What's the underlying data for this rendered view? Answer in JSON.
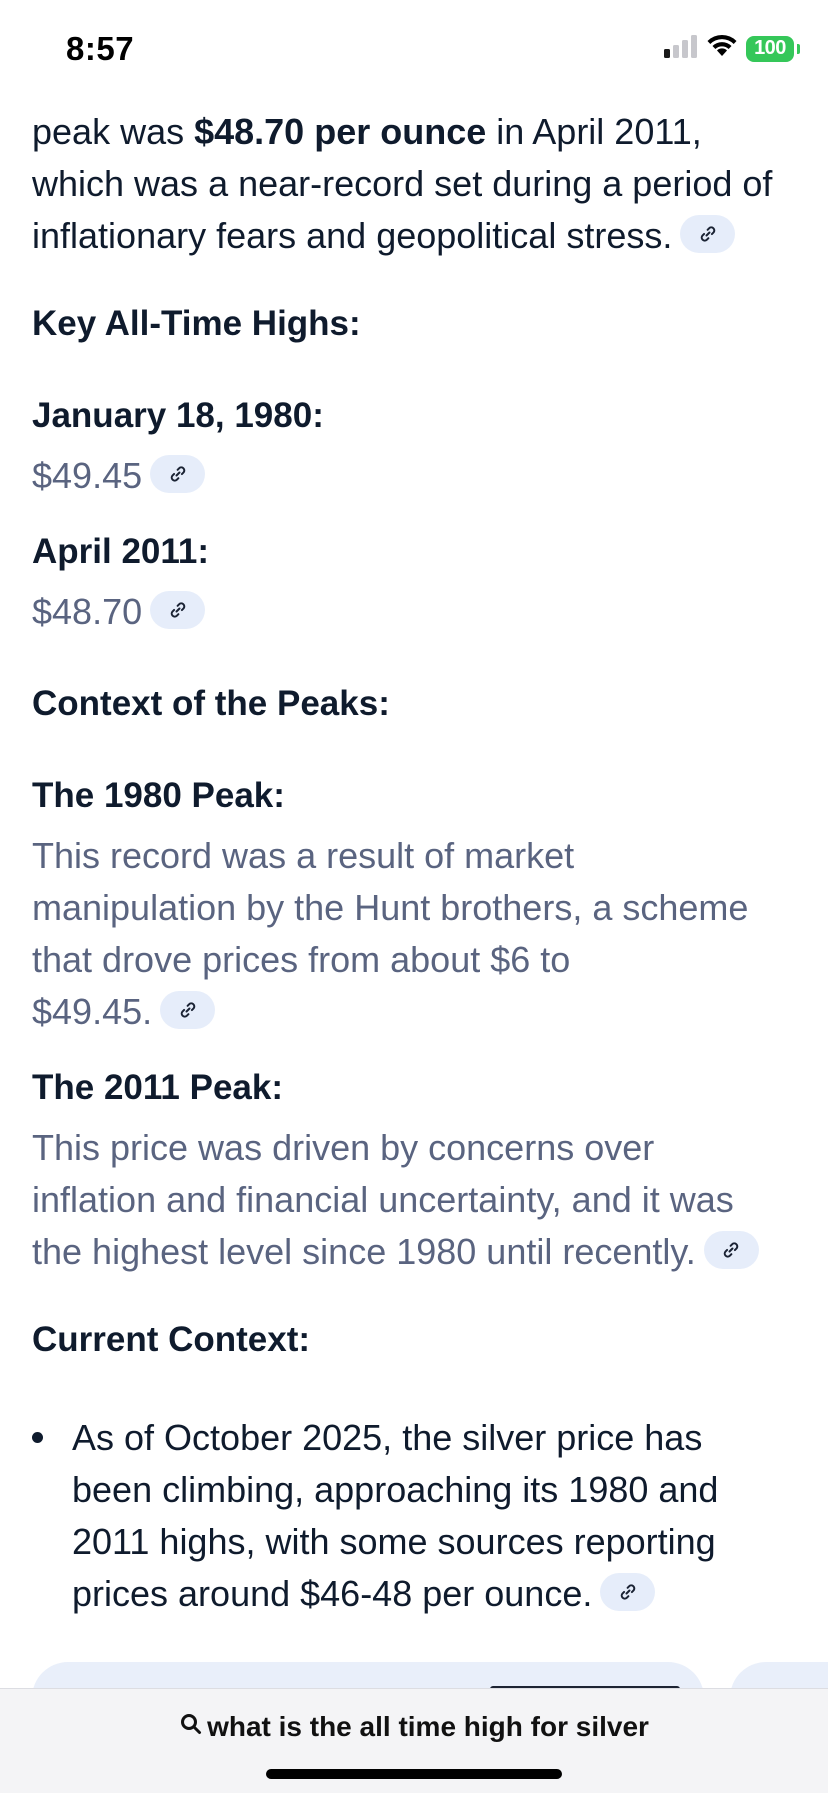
{
  "status_bar": {
    "time": "8:57",
    "battery": "100"
  },
  "intro": {
    "prefix": "peak was ",
    "bold": "$48.70 per ounce",
    "suffix_line1": " in April 2011,",
    "line2": "which was a near-record set during a period of",
    "line3": "inflationary fears and geopolitical stress."
  },
  "key_highs": {
    "heading": "Key All-Time Highs:",
    "items": [
      {
        "date": "January 18, 1980:",
        "value": "$49.45"
      },
      {
        "date": "April 2011:",
        "value": "$48.70"
      }
    ]
  },
  "context": {
    "heading": "Context of the Peaks:",
    "peak_1980": {
      "title": "The 1980 Peak:",
      "lines": [
        "This record was a result of market",
        "manipulation by the Hunt brothers, a scheme",
        "that drove prices from about $6 to",
        "$49.45."
      ]
    },
    "peak_2011": {
      "title": "The 2011 Peak:",
      "lines": [
        "This price was driven by concerns over",
        "inflation and financial uncertainty, and it was",
        "the highest level since 1980 until recently."
      ]
    }
  },
  "current": {
    "heading": "Current Context:",
    "bullets": [
      {
        "lines": [
          "As of October 2025, the silver price has",
          "been climbing, approaching its 1980 and",
          "2011 highs, with some sources reporting",
          "prices around $46-48 per ounce."
        ]
      }
    ]
  },
  "bottom_bar": {
    "query": "what is the all time high for silver"
  },
  "icons": {
    "link": "link-icon",
    "search": "search-icon",
    "signal": "cellular-signal-icon",
    "wifi": "wifi-icon",
    "battery": "battery-icon"
  },
  "colors": {
    "text_primary": "#0f1b2d",
    "text_muted": "#5a6480",
    "chip_bg": "#e6edfa",
    "battery_green": "#35c759"
  }
}
